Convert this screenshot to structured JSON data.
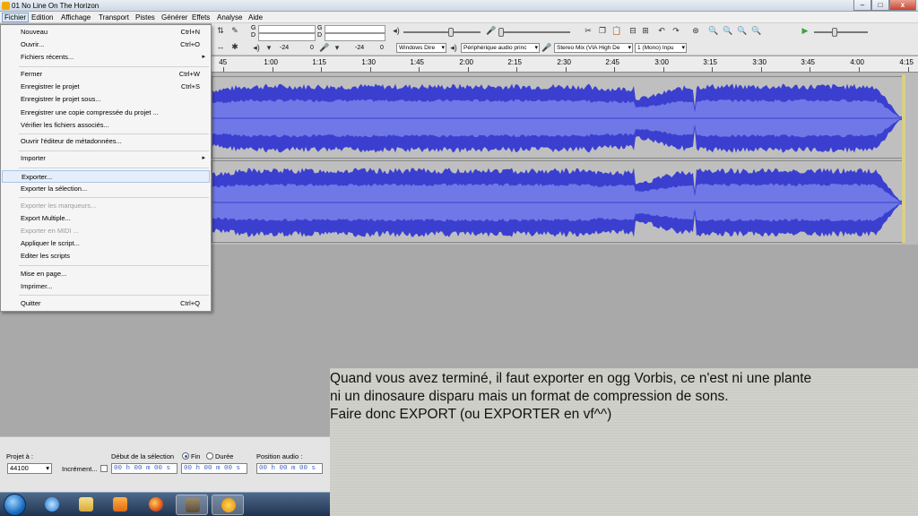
{
  "window": {
    "title": "01 No Line On The Horizon"
  },
  "menubar": {
    "items": [
      "Fichier",
      "Edition",
      "Affichage",
      "Transport",
      "Pistes",
      "Générer",
      "Effets",
      "Analyse",
      "Aide"
    ]
  },
  "file_menu": {
    "items": [
      {
        "label": "Nouveau",
        "shortcut": "Ctrl+N"
      },
      {
        "label": "Ouvrir...",
        "shortcut": "Ctrl+O"
      },
      {
        "label": "Fichiers récents...",
        "submenu": "▸"
      },
      {
        "label": "Fermer",
        "shortcut": "Ctrl+W"
      },
      {
        "label": "Enregistrer le projet",
        "shortcut": "Ctrl+S"
      },
      {
        "label": "Enregistrer le projet sous..."
      },
      {
        "label": "Enregistrer une copie compressée du projet ..."
      },
      {
        "label": "Vérifier les fichiers associés..."
      },
      {
        "label": "Ouvrir l'éditeur de métadonnées..."
      },
      {
        "label": "Importer",
        "submenu": "▸"
      },
      {
        "label": "Exporter..."
      },
      {
        "label": "Exporter la sélection..."
      },
      {
        "label": "Exporter les marqueurs..."
      },
      {
        "label": "Export Multiple..."
      },
      {
        "label": "Exporter en MIDI ..."
      },
      {
        "label": "Appliquer le script..."
      },
      {
        "label": "Editer les scripts"
      },
      {
        "label": "Mise en page..."
      },
      {
        "label": "Imprimer..."
      },
      {
        "label": "Quitter",
        "shortcut": "Ctrl+Q"
      }
    ]
  },
  "meters": {
    "left_letters": [
      "G",
      "D"
    ],
    "right_letters": [
      "G",
      "D"
    ],
    "scale_left": [
      "-24",
      "0"
    ],
    "scale_right": [
      "-24",
      "0"
    ]
  },
  "devices": {
    "host": "Windows Dire",
    "output": "Périphérique audio princ",
    "input": "Stereo Mix (VIA High De",
    "channels": "1 (Mono) Inpu"
  },
  "ruler": {
    "ticks": [
      "45",
      "1:00",
      "1:15",
      "1:30",
      "1:45",
      "2:00",
      "2:15",
      "2:30",
      "2:45",
      "3:00",
      "3:15",
      "3:30",
      "3:45",
      "4:00",
      "4:15"
    ]
  },
  "selection_toolbar": {
    "project_rate_label": "Projet à :",
    "project_rate": "44100",
    "snap_label": "Incrément...",
    "sel_start_label": "Début de la sélection",
    "end_label": "Fin",
    "duration_label": "Durée",
    "audio_pos_label": "Position audio :",
    "time_value": "00 h 00 m 00 s"
  },
  "caption": {
    "lines": [
      "Quand vous avez terminé, il faut exporter en ogg Vorbis, ce n'est ni une plante",
      "ni un dinosaure disparu mais un format de compression de sons.",
      "Faire donc EXPORT (ou EXPORTER en vf^^)"
    ]
  },
  "colors": {
    "waveform": "#3b3fd0",
    "waveform_rms": "#6f78e6",
    "menu_highlight": "#e5eefb"
  },
  "icons": {
    "start": "windows-start-orb-icon",
    "ie": "internet-explorer-icon",
    "explorer": "folder-icon",
    "media": "media-player-icon",
    "firefox": "firefox-icon",
    "gimp": "gimp-icon",
    "audacity": "audacity-icon"
  }
}
